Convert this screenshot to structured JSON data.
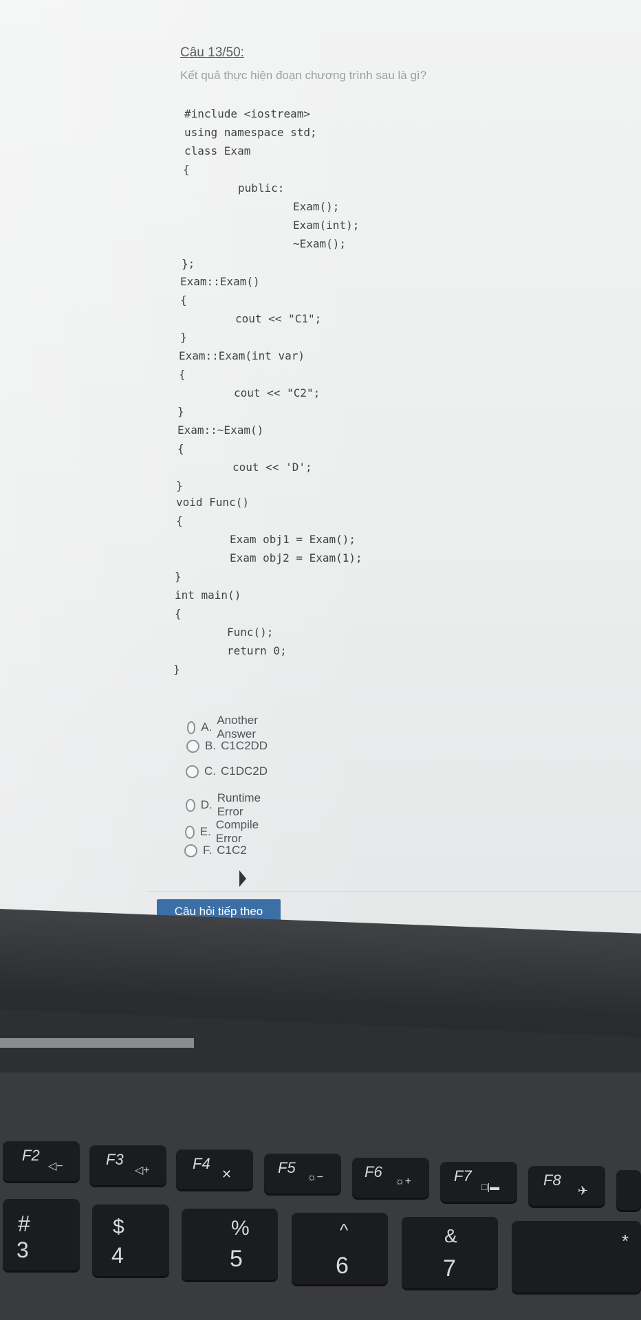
{
  "question": {
    "title": "Câu 13/50:",
    "prompt": "Kết quả thực hiện đoạn chương trình sau là gì?"
  },
  "code_lines": [
    "#include <iostream>",
    "using namespace std;",
    "class Exam",
    "{",
    "public:",
    "Exam();",
    "Exam(int);",
    "~Exam();",
    "};",
    "Exam::Exam()",
    "{",
    "cout << \"C1\";",
    "}",
    "Exam::Exam(int var)",
    "{",
    "cout << \"C2\";",
    "}",
    "Exam::~Exam()",
    "{",
    "cout << 'D';",
    "}",
    "void Func()",
    "{",
    "Exam obj1 = Exam();",
    "Exam obj2 = Exam(1);",
    "}",
    "int main()",
    "{",
    "Func();",
    "return 0;",
    "}"
  ],
  "options": [
    {
      "letter": "A.",
      "text": "Another Answer"
    },
    {
      "letter": "B.",
      "text": "C1C2DD"
    },
    {
      "letter": "C.",
      "text": "C1DC2D"
    },
    {
      "letter": "D.",
      "text": "Runtime Error"
    },
    {
      "letter": "E.",
      "text": "Compile Error"
    },
    {
      "letter": "F.",
      "text": "C1C2"
    }
  ],
  "next_button": "Câu hỏi tiếp theo",
  "keyboard": {
    "fkeys": [
      "F2",
      "F3",
      "F4",
      "F5",
      "F6",
      "F7",
      "F8"
    ],
    "number_row": [
      {
        "top": "#",
        "bottom": "3"
      },
      {
        "top": "$",
        "bottom": "4"
      },
      {
        "top": "%",
        "bottom": "5"
      },
      {
        "top": "^",
        "bottom": "6"
      },
      {
        "top": "&",
        "bottom": "7"
      }
    ]
  }
}
